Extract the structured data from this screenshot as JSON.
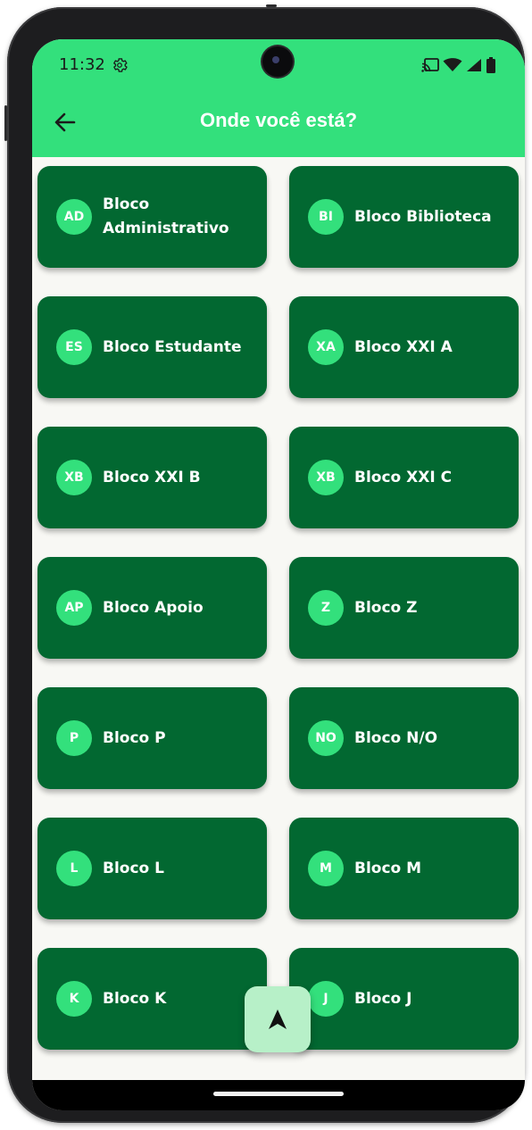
{
  "status_bar": {
    "time": "11:32",
    "icons": [
      "settings-gear-icon",
      "cast-icon",
      "wifi-icon",
      "signal-icon",
      "battery-icon"
    ]
  },
  "app_bar": {
    "title": "Onde você está?",
    "back_icon": "arrow-left-icon"
  },
  "colors": {
    "app_bar": "#33e07c",
    "card": "#026831",
    "badge": "#33e07c",
    "fab": "#b7f0c8",
    "background": "#f8f8f4"
  },
  "blocks": [
    {
      "initials": "AD",
      "label": "Bloco Administrativo"
    },
    {
      "initials": "BI",
      "label": "Bloco Biblioteca"
    },
    {
      "initials": "ES",
      "label": "Bloco Estudante"
    },
    {
      "initials": "XA",
      "label": "Bloco XXI A"
    },
    {
      "initials": "XB",
      "label": "Bloco XXI B"
    },
    {
      "initials": "XB",
      "label": "Bloco XXI C"
    },
    {
      "initials": "AP",
      "label": "Bloco Apoio"
    },
    {
      "initials": "Z",
      "label": "Bloco Z"
    },
    {
      "initials": "P",
      "label": "Bloco P"
    },
    {
      "initials": "NO",
      "label": "Bloco N/O"
    },
    {
      "initials": "L",
      "label": "Bloco L"
    },
    {
      "initials": "M",
      "label": "Bloco M"
    },
    {
      "initials": "K",
      "label": "Bloco K"
    },
    {
      "initials": "J",
      "label": "Bloco J"
    }
  ],
  "fab": {
    "icon": "navigation-arrow-icon"
  }
}
